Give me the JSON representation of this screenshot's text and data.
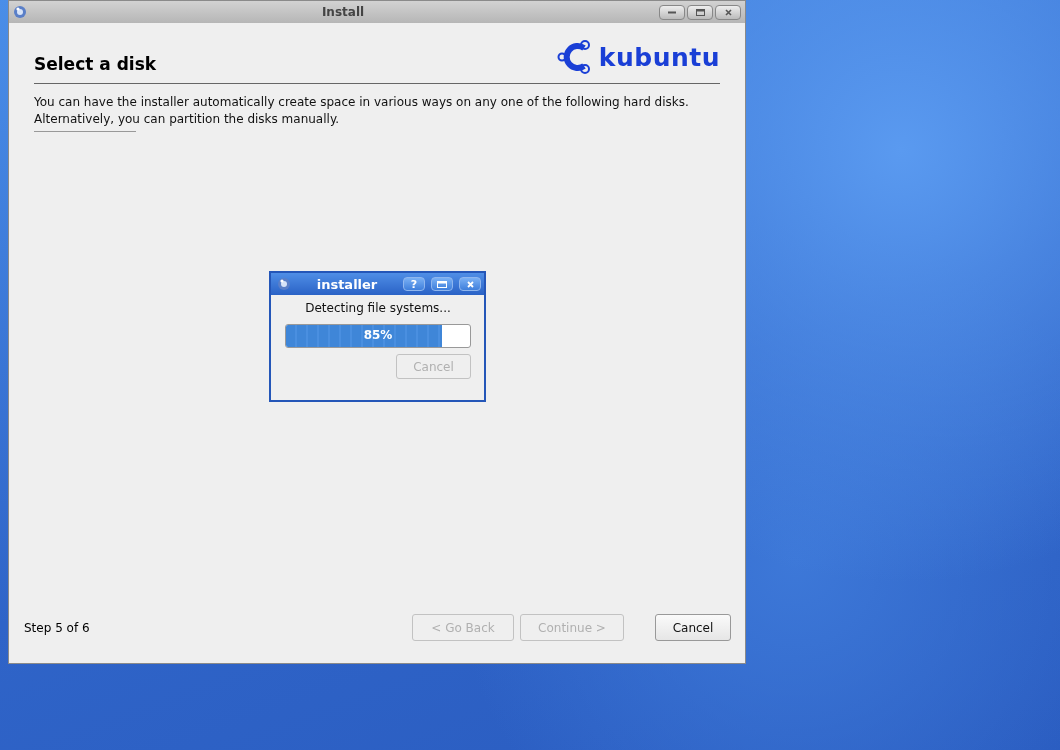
{
  "window": {
    "title": "Install",
    "buttons": [
      {
        "kind": "minimize"
      },
      {
        "kind": "maximize"
      },
      {
        "kind": "close"
      }
    ]
  },
  "header": {
    "title": "Select a disk",
    "logo_text": "kubuntu"
  },
  "description": "You can have the installer automatically create space in various ways on any one of the following hard disks. Alternatively, you can partition the disks manually.",
  "progress_dialog": {
    "title": "installer",
    "buttons": [
      {
        "kind": "help",
        "label": "?"
      },
      {
        "kind": "maximize"
      },
      {
        "kind": "close"
      }
    ],
    "message": "Detecting file systems...",
    "level": 0.85,
    "reading": "85%",
    "cancel": {
      "label": "Cancel",
      "disabled": true
    }
  },
  "footer": {
    "step": "Step 5 of 6",
    "buttons": [
      {
        "label": "< Go Back",
        "disabled": true
      },
      {
        "label": "Continue >",
        "disabled": true
      },
      {
        "label": "Cancel",
        "disabled": false
      }
    ]
  }
}
